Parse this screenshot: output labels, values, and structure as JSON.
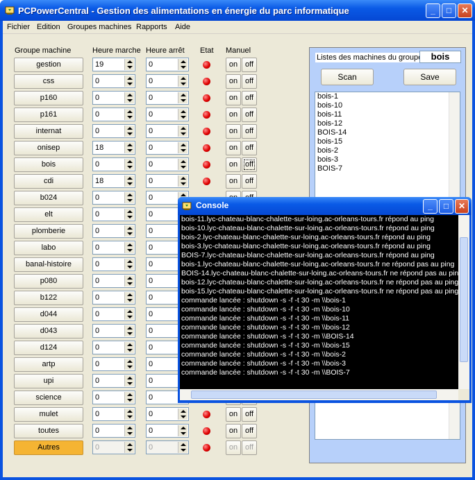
{
  "window": {
    "title": "PCPowerCentral  - Gestion des alimentations en énergie du parc informatique"
  },
  "menu": [
    "Fichier",
    "Edition",
    "Groupes machines",
    "Rapports",
    "Aide"
  ],
  "headers": {
    "group": "Groupe machine",
    "start": "Heure marche",
    "stop": "Heure arrêt",
    "state": "Etat",
    "manual": "Manuel"
  },
  "buttons": {
    "on": "on",
    "off": "off"
  },
  "colors": {
    "title_bar": "#0a53e0",
    "panel": "#b7d0fa",
    "autres_button": "#f5b433",
    "led": "#e00000"
  },
  "groups": [
    {
      "name": "gestion",
      "start": "19",
      "stop": "0",
      "led": true
    },
    {
      "name": "css",
      "start": "0",
      "stop": "0",
      "led": true
    },
    {
      "name": "p160",
      "start": "0",
      "stop": "0",
      "led": true
    },
    {
      "name": "p161",
      "start": "0",
      "stop": "0",
      "led": true
    },
    {
      "name": "internat",
      "start": "0",
      "stop": "0",
      "led": true
    },
    {
      "name": "onisep",
      "start": "18",
      "stop": "0",
      "led": true
    },
    {
      "name": "bois",
      "start": "0",
      "stop": "0",
      "led": true
    },
    {
      "name": "cdi",
      "start": "18",
      "stop": "0",
      "led": true
    },
    {
      "name": "b024",
      "start": "0",
      "stop": "0",
      "led": false
    },
    {
      "name": "elt",
      "start": "0",
      "stop": "0",
      "led": false
    },
    {
      "name": "plomberie",
      "start": "0",
      "stop": "0",
      "led": false
    },
    {
      "name": "labo",
      "start": "0",
      "stop": "0",
      "led": false
    },
    {
      "name": "banal-histoire",
      "start": "0",
      "stop": "0",
      "led": false
    },
    {
      "name": "p080",
      "start": "0",
      "stop": "0",
      "led": false
    },
    {
      "name": "b122",
      "start": "0",
      "stop": "0",
      "led": false
    },
    {
      "name": "d044",
      "start": "0",
      "stop": "0",
      "led": false
    },
    {
      "name": "d043",
      "start": "0",
      "stop": "0",
      "led": false
    },
    {
      "name": "d124",
      "start": "0",
      "stop": "0",
      "led": false
    },
    {
      "name": "artp",
      "start": "0",
      "stop": "0",
      "led": false
    },
    {
      "name": "upi",
      "start": "0",
      "stop": "0",
      "led": false
    },
    {
      "name": "science",
      "start": "0",
      "stop": "0",
      "led": false
    },
    {
      "name": "mulet",
      "start": "0",
      "stop": "0",
      "led": true
    },
    {
      "name": "toutes",
      "start": "0",
      "stop": "0",
      "led": true
    },
    {
      "name": "Autres",
      "start": "0",
      "stop": "0",
      "led": true
    }
  ],
  "panel": {
    "label": "Listes des machines du groupe",
    "group": "bois",
    "scan": "Scan",
    "save": "Save",
    "machines": [
      "bois-1",
      "bois-10",
      "bois-11",
      "bois-12",
      "BOIS-14",
      "bois-15",
      "bois-2",
      "bois-3",
      "BOIS-7"
    ]
  },
  "console": {
    "title": "Console",
    "lines": [
      "bois-11.lyc-chateau-blanc-chalette-sur-loing.ac-orleans-tours.fr répond au ping",
      "bois-10.lyc-chateau-blanc-chalette-sur-loing.ac-orleans-tours.fr répond au ping",
      "bois-2.lyc-chateau-blanc-chalette-sur-loing.ac-orleans-tours.fr répond au ping",
      "bois-3.lyc-chateau-blanc-chalette-sur-loing.ac-orleans-tours.fr répond au ping",
      "BOIS-7.lyc-chateau-blanc-chalette-sur-loing.ac-orleans-tours.fr répond au ping",
      "bois-1.lyc-chateau-blanc-chalette-sur-loing.ac-orleans-tours.fr ne répond pas au ping",
      "BOIS-14.lyc-chateau-blanc-chalette-sur-loing.ac-orleans-tours.fr ne répond pas au ping",
      "bois-12.lyc-chateau-blanc-chalette-sur-loing.ac-orleans-tours.fr ne répond pas au ping",
      "bois-15.lyc-chateau-blanc-chalette-sur-loing.ac-orleans-tours.fr ne répond pas au ping",
      "commande lancée : shutdown -s -f -t 30 -m \\\\bois-1",
      "commande lancée : shutdown -s -f -t 30 -m \\\\bois-10",
      "commande lancée : shutdown -s -f -t 30 -m \\\\bois-11",
      "commande lancée : shutdown -s -f -t 30 -m \\\\bois-12",
      "commande lancée : shutdown -s -f -t 30 -m \\\\BOIS-14",
      "commande lancée : shutdown -s -f -t 30 -m \\\\bois-15",
      "commande lancée : shutdown -s -f -t 30 -m \\\\bois-2",
      "commande lancée : shutdown -s -f -t 30 -m \\\\bois-3",
      "commande lancée : shutdown -s -f -t 30 -m \\\\BOIS-7"
    ]
  }
}
